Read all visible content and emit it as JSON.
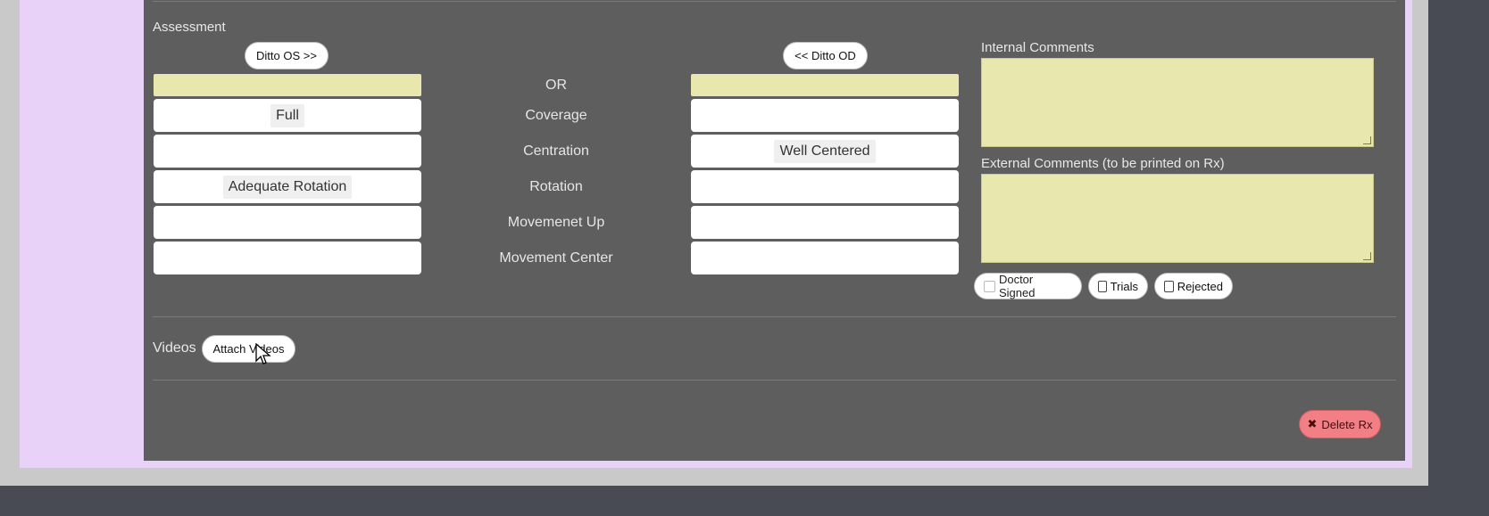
{
  "assessment": {
    "title": "Assessment",
    "ditto_os_label": "Ditto OS >>",
    "ditto_od_label": "<< Ditto OD",
    "rows": [
      {
        "label": "OR",
        "os": "",
        "od": ""
      },
      {
        "label": "Coverage",
        "os": "Full",
        "od": ""
      },
      {
        "label": "Centration",
        "os": "",
        "od": "Well Centered"
      },
      {
        "label": "Rotation",
        "os": "Adequate Rotation",
        "od": ""
      },
      {
        "label": "Movemenet Up",
        "os": "",
        "od": ""
      },
      {
        "label": "Movement Center",
        "os": "",
        "od": ""
      }
    ]
  },
  "comments": {
    "internal_label": "Internal Comments",
    "internal_value": "",
    "external_label": "External Comments (to be printed on Rx)",
    "external_value": ""
  },
  "flags": {
    "doctor_signed": {
      "label": "Doctor Signed",
      "checked": false,
      "disabled": true
    },
    "trials": {
      "label": "Trials",
      "checked": false
    },
    "rejected": {
      "label": "Rejected",
      "checked": false
    }
  },
  "videos": {
    "label": "Videos",
    "attach_label": "Attach Videos"
  },
  "actions": {
    "delete_label": "Delete Rx",
    "delete_icon": "x-icon"
  },
  "colors": {
    "panel": "#5e5e5e",
    "field_yellow": "#e8e8ae",
    "delete_red": "#f27f86",
    "side_pink": "#e9d2f7"
  }
}
